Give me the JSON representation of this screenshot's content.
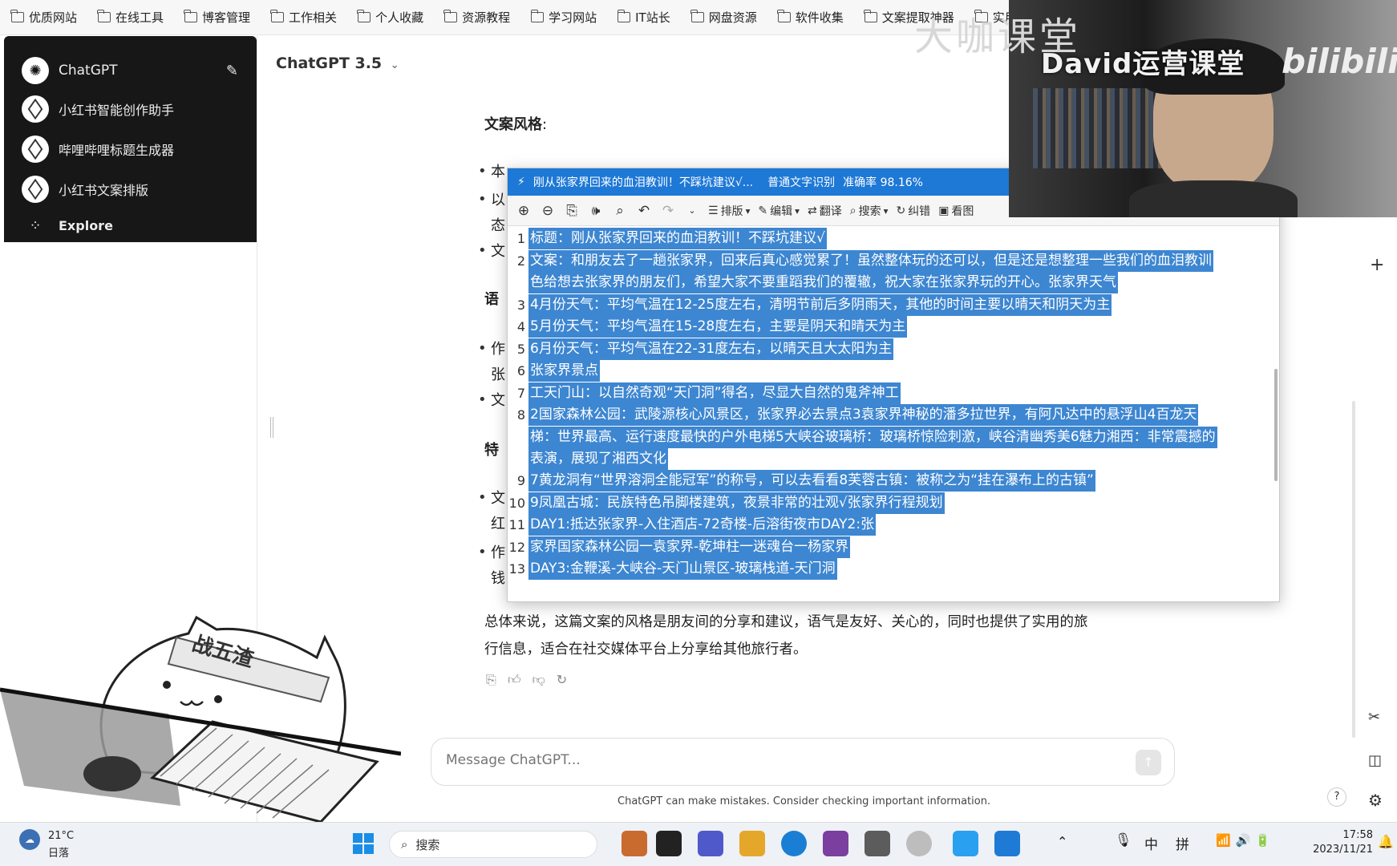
{
  "bookmarks": [
    "优质网站",
    "在线工具",
    "博客管理",
    "工作相关",
    "个人收藏",
    "资源教程",
    "学习网站",
    "IT站长",
    "网盘资源",
    "软件收集",
    "文案提取神器",
    "实用"
  ],
  "sidebar": {
    "brand": "ChatGPT",
    "items": [
      {
        "label": "小红书智能创作助手"
      },
      {
        "label": "哔哩哔哩标题生成器"
      },
      {
        "label": "小红书文案排版"
      }
    ],
    "explore": "Explore"
  },
  "header": {
    "model": "ChatGPT 3.5"
  },
  "main": {
    "section_style": "文案风格",
    "section_style_colon": ":",
    "bullet1_start": "本",
    "bullet2_start": "以",
    "bullet2_cont": "态",
    "bullet3_start": "文",
    "section_tone": "语",
    "tone_b1": "作",
    "tone_b1_cont": "张",
    "tone_b2": "文",
    "section_feature": "特",
    "feat_b1": "文",
    "feat_b1_cont": "红",
    "feat_b2": "作",
    "feat_b2_cont": "钱",
    "summary_line1": "总体来说，这篇文案的风格是朋友间的分享和建议，语气是友好、关心的，同时也提供了实用的旅",
    "summary_line2": "行信息，适合在社交媒体平台上分享给其他旅行者。"
  },
  "ocr": {
    "title": "刚从张家界回来的血泪教训！不踩坑建议√...",
    "mode": "普通文字识别",
    "accuracy": "准确率 98.16%",
    "toolbar": {
      "layout": "排版",
      "edit": "编辑",
      "translate": "翻译",
      "search": "搜索",
      "correct": "纠错",
      "view": "看图"
    },
    "lines": [
      {
        "n": "1",
        "t": "标题：刚从张家界回来的血泪教训！不踩坑建议√"
      },
      {
        "n": "2",
        "t": "文案：和朋友去了一趟张家界，回来后真心感觉累了！虽然整体玩的还可以，但是还是想整理一些我们的血泪教训"
      },
      {
        "n": "",
        "t": "色给想去张家界的朋友们，希望大家不要重蹈我们的覆辙，祝大家在张家界玩的开心。张家界天气"
      },
      {
        "n": "3",
        "t": "4月份天气：平均气温在12-25度左右，清明节前后多阴雨天，其他的时间主要以晴天和阴天为主"
      },
      {
        "n": "4",
        "t": "5月份天气：平均气温在15-28度左右，主要是阴天和晴天为主"
      },
      {
        "n": "5",
        "t": "6月份天气：平均气温在22-31度左右，以晴天且大太阳为主"
      },
      {
        "n": "6",
        "t": "张家界景点"
      },
      {
        "n": "7",
        "t": "工天门山：以自然奇观“天门洞”得名，尽显大自然的鬼斧神工"
      },
      {
        "n": "8",
        "t": "2国家森林公园：武陵源核心风景区，张家界必去景点3袁家界神秘的潘多拉世界，有阿凡达中的悬浮山4百龙天"
      },
      {
        "n": "",
        "t": "梯：世界最高、运行速度最快的户外电梯5大峡谷玻璃桥：玻璃桥惊险刺激，峡谷清幽秀美6魅力湘西：非常震撼的"
      },
      {
        "n": "",
        "t": "表演，展现了湘西文化"
      },
      {
        "n": "9",
        "t": "7黄龙洞有“世界溶洞全能冠军”的称号，可以去看看8芙蓉古镇：被称之为“挂在瀑布上的古镇”"
      },
      {
        "n": "10",
        "t": "9凤凰古城：民族特色吊脚楼建筑，夜景非常的壮观√张家界行程规划"
      },
      {
        "n": "11",
        "t": "DAY1:抵达张家界-入住酒店-72奇楼-后溶街夜市DAY2:张"
      },
      {
        "n": "12",
        "t": "家界国家森林公园一袁家界-乾坤柱一迷魂台一杨家界"
      },
      {
        "n": "13",
        "t": "DAY3:金鞭溪-大峡谷-天门山景区-玻璃栈道-天门洞"
      }
    ]
  },
  "cam": {
    "watermark": "David运营课堂",
    "logo": "bilibili",
    "badge": "大咖课堂"
  },
  "composer": {
    "placeholder": "Message ChatGPT..."
  },
  "disclaimer": "ChatGPT can make mistakes. Consider checking important information.",
  "sticker": {
    "banner": "战五渣"
  },
  "taskbar": {
    "temp": "21°C",
    "weather": "日落",
    "search": "搜索",
    "ime1": "中",
    "ime2": "拼",
    "time": "17:58",
    "date": "2023/11/21"
  }
}
